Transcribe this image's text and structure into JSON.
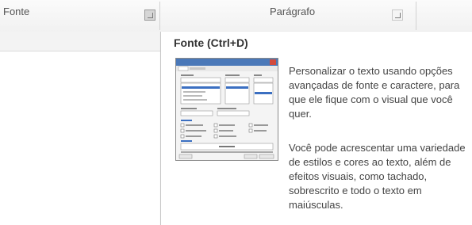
{
  "ribbon": {
    "groups": [
      {
        "label": "Fonte"
      },
      {
        "label": "Parágrafo"
      }
    ]
  },
  "tooltip": {
    "title": "Fonte (Ctrl+D)",
    "description_1": "Personalizar o texto usando opções avançadas de fonte e caractere, para que ele fique com o visual que você quer.",
    "description_2": "Você pode acrescentar uma variedade de estilos e cores ao texto, além de efeitos visuais, como tachado, sobrescrito e todo o texto em maiúsculas."
  }
}
